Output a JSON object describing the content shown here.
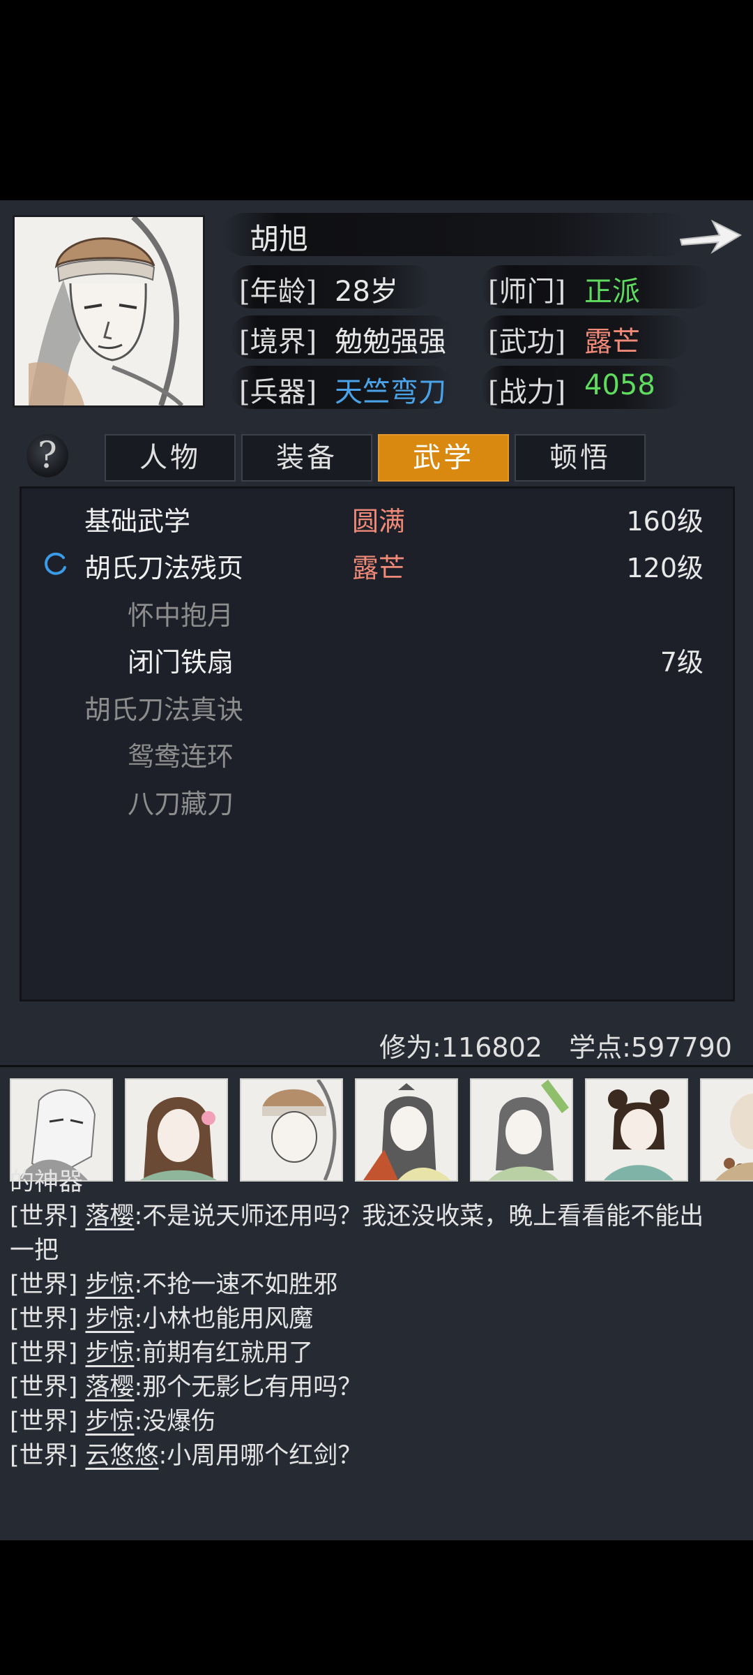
{
  "character": {
    "name": "胡旭",
    "age_label": "[年龄]",
    "age_value": "28岁",
    "sect_label": "[师门]",
    "sect_value": "正派",
    "realm_label": "[境界]",
    "realm_value": "勉勉强强",
    "martial_label": "[武功]",
    "martial_value": "露芒",
    "weapon_label": "[兵器]",
    "weapon_value": "天竺弯刀",
    "power_label": "[战力]",
    "power_value": "4058"
  },
  "tabs": [
    {
      "label": "人物",
      "active": false
    },
    {
      "label": "装备",
      "active": false
    },
    {
      "label": "武学",
      "active": true
    },
    {
      "label": "顿悟",
      "active": false
    }
  ],
  "help_glyph": "?",
  "skills": [
    {
      "name": "基础武学",
      "status": "圆满",
      "level": "160级"
    },
    {
      "name": "胡氏刀法残页",
      "status": "露芒",
      "level": "120级"
    },
    {
      "name": "怀中抱月",
      "status": "",
      "level": ""
    },
    {
      "name": "闭门铁扇",
      "status": "",
      "level": "7级"
    },
    {
      "name": "胡氏刀法真诀",
      "status": "",
      "level": ""
    },
    {
      "name": "鸳鸯连环",
      "status": "",
      "level": ""
    },
    {
      "name": "八刀藏刀",
      "status": "",
      "level": ""
    }
  ],
  "stats": {
    "cultivation": "修为:116802",
    "points": "学点:597790"
  },
  "chat": {
    "partial_top": "的神器",
    "messages": [
      {
        "channel": "[世界]",
        "user": "落樱",
        "text": ":不是说天师还用吗？我还没收菜，晚上看看能不能出",
        "cont": "一把"
      },
      {
        "channel": "[世界]",
        "user": "步惊",
        "text": ":不抢一速不如胜邪"
      },
      {
        "channel": "[世界]",
        "user": "步惊",
        "text": ":小林也能用风魔"
      },
      {
        "channel": "[世界]",
        "user": "步惊",
        "text": ":前期有红就用了"
      },
      {
        "channel": "[世界]",
        "user": "落樱",
        "text": ":那个无影匕有用吗？"
      },
      {
        "channel": "[世界]",
        "user": "步惊",
        "text": ":没爆伤"
      },
      {
        "channel": "[世界]",
        "user": "云悠悠",
        "text": ":小周用哪个红剑？"
      }
    ]
  },
  "colors": {
    "green": "#5fdc5f",
    "salmon": "#f08a78",
    "blue": "#4aa3e8",
    "orange_tab": "#d98810",
    "dim": "#8d8d8d"
  },
  "avatars": [
    "white-haired-hero-avatar",
    "lady-with-flower-avatar",
    "fur-hat-hero-avatar",
    "scholar-with-fan-avatar",
    "lady-with-sword-avatar",
    "girl-with-buns-avatar",
    "monk-avatar"
  ]
}
